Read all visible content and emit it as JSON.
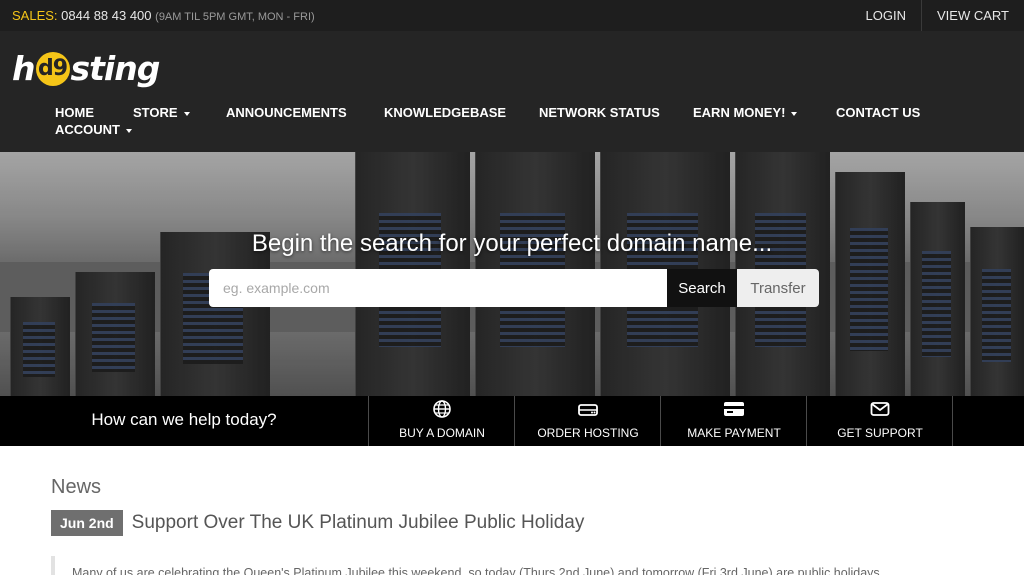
{
  "topbar": {
    "sales_label": "SALES:",
    "phone": "0844 88 43 400",
    "hours": "(9AM TIL 5PM GMT, MON - FRI)",
    "login": "LOGIN",
    "view_cart": "VIEW CART"
  },
  "logo": {
    "pre": "h",
    "mark": "d9",
    "post": "sting"
  },
  "nav": {
    "home": "HOME",
    "store": "STORE",
    "announcements": "ANNOUNCEMENTS",
    "knowledgebase": "KNOWLEDGEBASE",
    "network_status": "NETWORK STATUS",
    "earn_money": "EARN MONEY!",
    "contact_us": "CONTACT US",
    "account": "ACCOUNT"
  },
  "hero": {
    "title": "Begin the search for your perfect domain name...",
    "placeholder": "eg. example.com",
    "search_label": "Search",
    "transfer_label": "Transfer"
  },
  "help": {
    "prompt": "How can we help today?",
    "tiles": [
      {
        "label": "BUY A DOMAIN",
        "icon": "globe-icon"
      },
      {
        "label": "ORDER HOSTING",
        "icon": "server-icon"
      },
      {
        "label": "MAKE PAYMENT",
        "icon": "credit-card-icon"
      },
      {
        "label": "GET SUPPORT",
        "icon": "envelope-icon"
      }
    ]
  },
  "news": {
    "heading": "News",
    "items": [
      {
        "date": "Jun 2nd",
        "title": "Support Over The UK Platinum Jubilee Public Holiday",
        "excerpt": "Many of us are celebrating the Queen's Platinum Jubilee this weekend, so today (Thurs 2nd June) and tomorrow (Fri 3rd June) are public holidays..."
      }
    ]
  },
  "colors": {
    "accent": "#f5c518",
    "topbar_bg": "#1e1e1e",
    "header_bg": "#252525",
    "helpbar_bg": "#000000"
  }
}
